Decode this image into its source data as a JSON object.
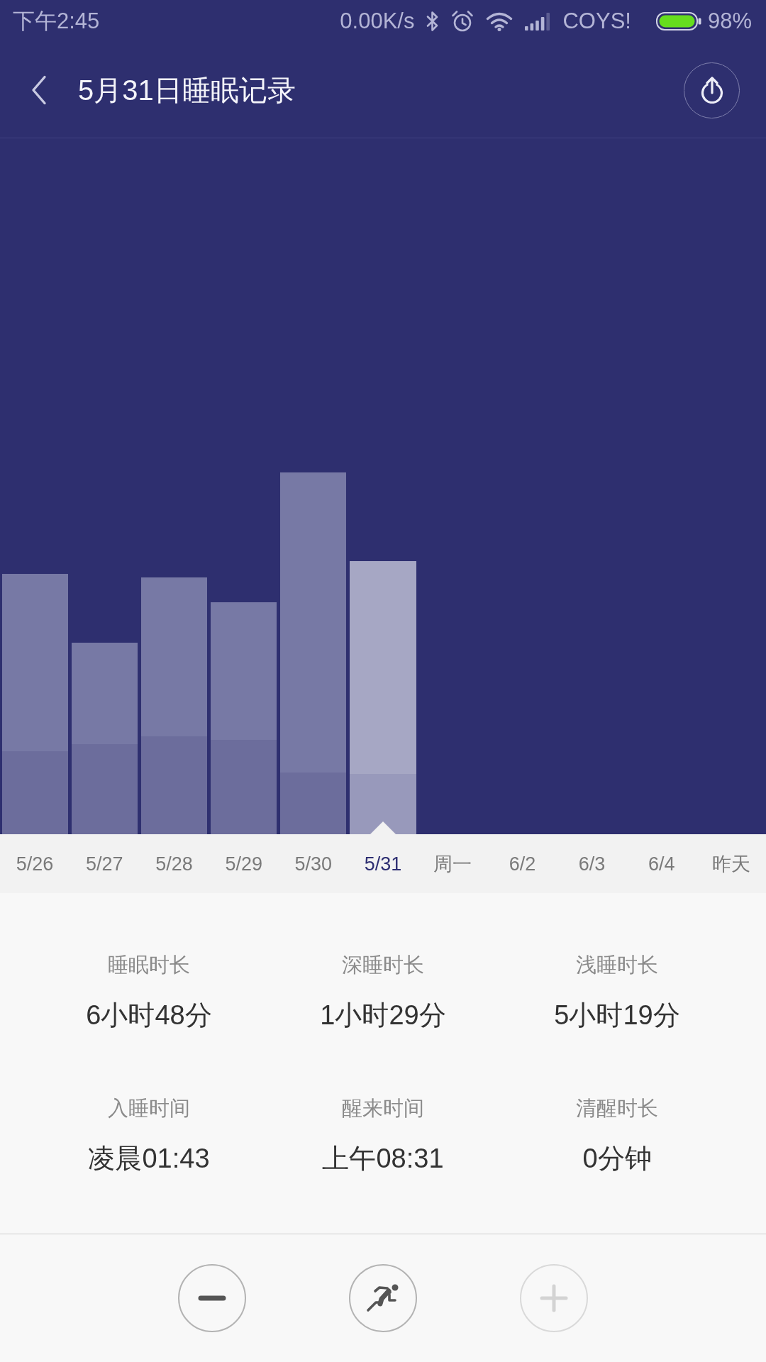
{
  "status_bar": {
    "time": "下午2:45",
    "net_speed": "0.00K/s",
    "carrier": "COYS!",
    "battery": "98%"
  },
  "header": {
    "title": "5月31日睡眠记录"
  },
  "dates": [
    {
      "label": "5/26",
      "selected": false
    },
    {
      "label": "5/27",
      "selected": false
    },
    {
      "label": "5/28",
      "selected": false
    },
    {
      "label": "5/29",
      "selected": false
    },
    {
      "label": "5/30",
      "selected": false
    },
    {
      "label": "5/31",
      "selected": true
    },
    {
      "label": "周一",
      "selected": false
    },
    {
      "label": "6/2",
      "selected": false
    },
    {
      "label": "6/3",
      "selected": false
    },
    {
      "label": "6/4",
      "selected": false
    },
    {
      "label": "昨天",
      "selected": false
    }
  ],
  "stats": [
    {
      "label": "睡眠时长",
      "value": "6小时48分"
    },
    {
      "label": "深睡时长",
      "value": "1小时29分"
    },
    {
      "label": "浅睡时长",
      "value": "5小时19分"
    },
    {
      "label": "入睡时间",
      "value": "凌晨01:43"
    },
    {
      "label": "醒来时间",
      "value": "上午08:31"
    },
    {
      "label": "清醒时长",
      "value": "0分钟"
    }
  ],
  "controls": [
    {
      "kind": "minus",
      "disabled": false
    },
    {
      "kind": "sprint",
      "disabled": false
    },
    {
      "kind": "plus",
      "disabled": true
    }
  ]
}
